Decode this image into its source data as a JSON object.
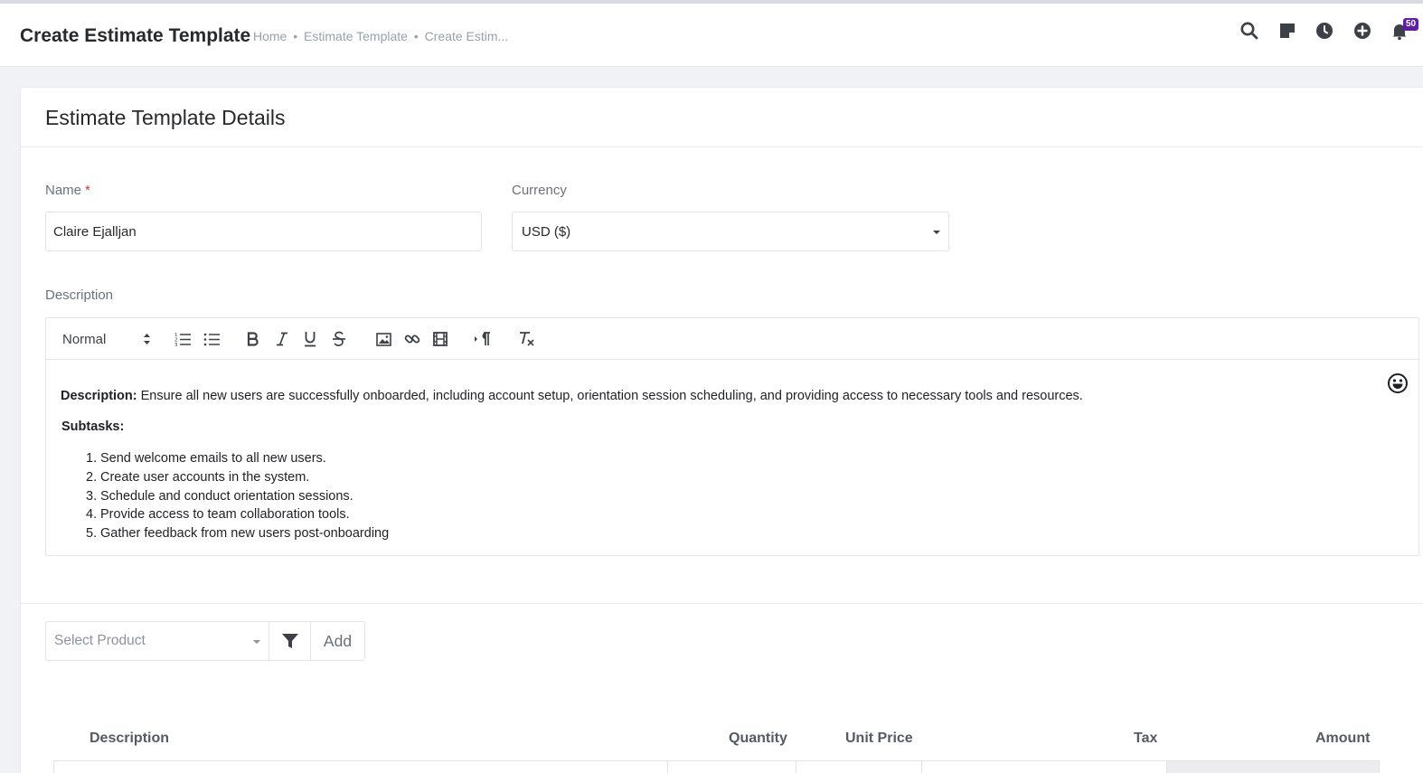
{
  "header": {
    "title": "Create Estimate Template",
    "breadcrumb": [
      "Home",
      "Estimate Template",
      "Create Estim..."
    ],
    "breadcrumb_sep": "•",
    "icons": [
      "search-icon",
      "sticky-note-icon",
      "clock-icon",
      "plus-circle-icon",
      "bell-icon"
    ],
    "notification_count": "50"
  },
  "card": {
    "title": "Estimate Template Details"
  },
  "form": {
    "name_label": "Name",
    "name_required": "*",
    "name_value": "Claire Ejalljan",
    "currency_label": "Currency",
    "currency_value": "USD ($)",
    "description_label": "Description"
  },
  "editor": {
    "format_select": "Normal",
    "toolbar_icons": [
      "ordered-list-icon",
      "bullet-list-icon",
      "bold-icon",
      "italic-icon",
      "underline-icon",
      "strikethrough-icon",
      "image-icon",
      "link-icon",
      "video-icon",
      "text-direction-icon",
      "clear-format-icon"
    ],
    "desc_label": "Description:",
    "desc_text": " Ensure all new users are successfully onboarded, including account setup, orientation session scheduling, and providing access to necessary tools and resources.",
    "subtasks_label": "Subtasks:",
    "subtasks": [
      {
        "num": "1.",
        "text": "Send welcome emails to all new users."
      },
      {
        "num": "2.",
        "text": "Create user accounts in the system."
      },
      {
        "num": "3.",
        "text": "Schedule and conduct orientation sessions."
      },
      {
        "num": "4.",
        "text": "Provide access to team collaboration tools."
      },
      {
        "num": "5.",
        "text": "Gather feedback from new users post-onboarding"
      }
    ]
  },
  "product": {
    "select_placeholder": "Select Product",
    "add_label": "Add"
  },
  "table": {
    "headers": [
      "Description",
      "Quantity",
      "Unit Price",
      "Tax",
      "Amount"
    ]
  },
  "colors": {
    "accent": "#5e1fa4",
    "required": "#e0312d",
    "page_bg": "#f1f2f6"
  }
}
